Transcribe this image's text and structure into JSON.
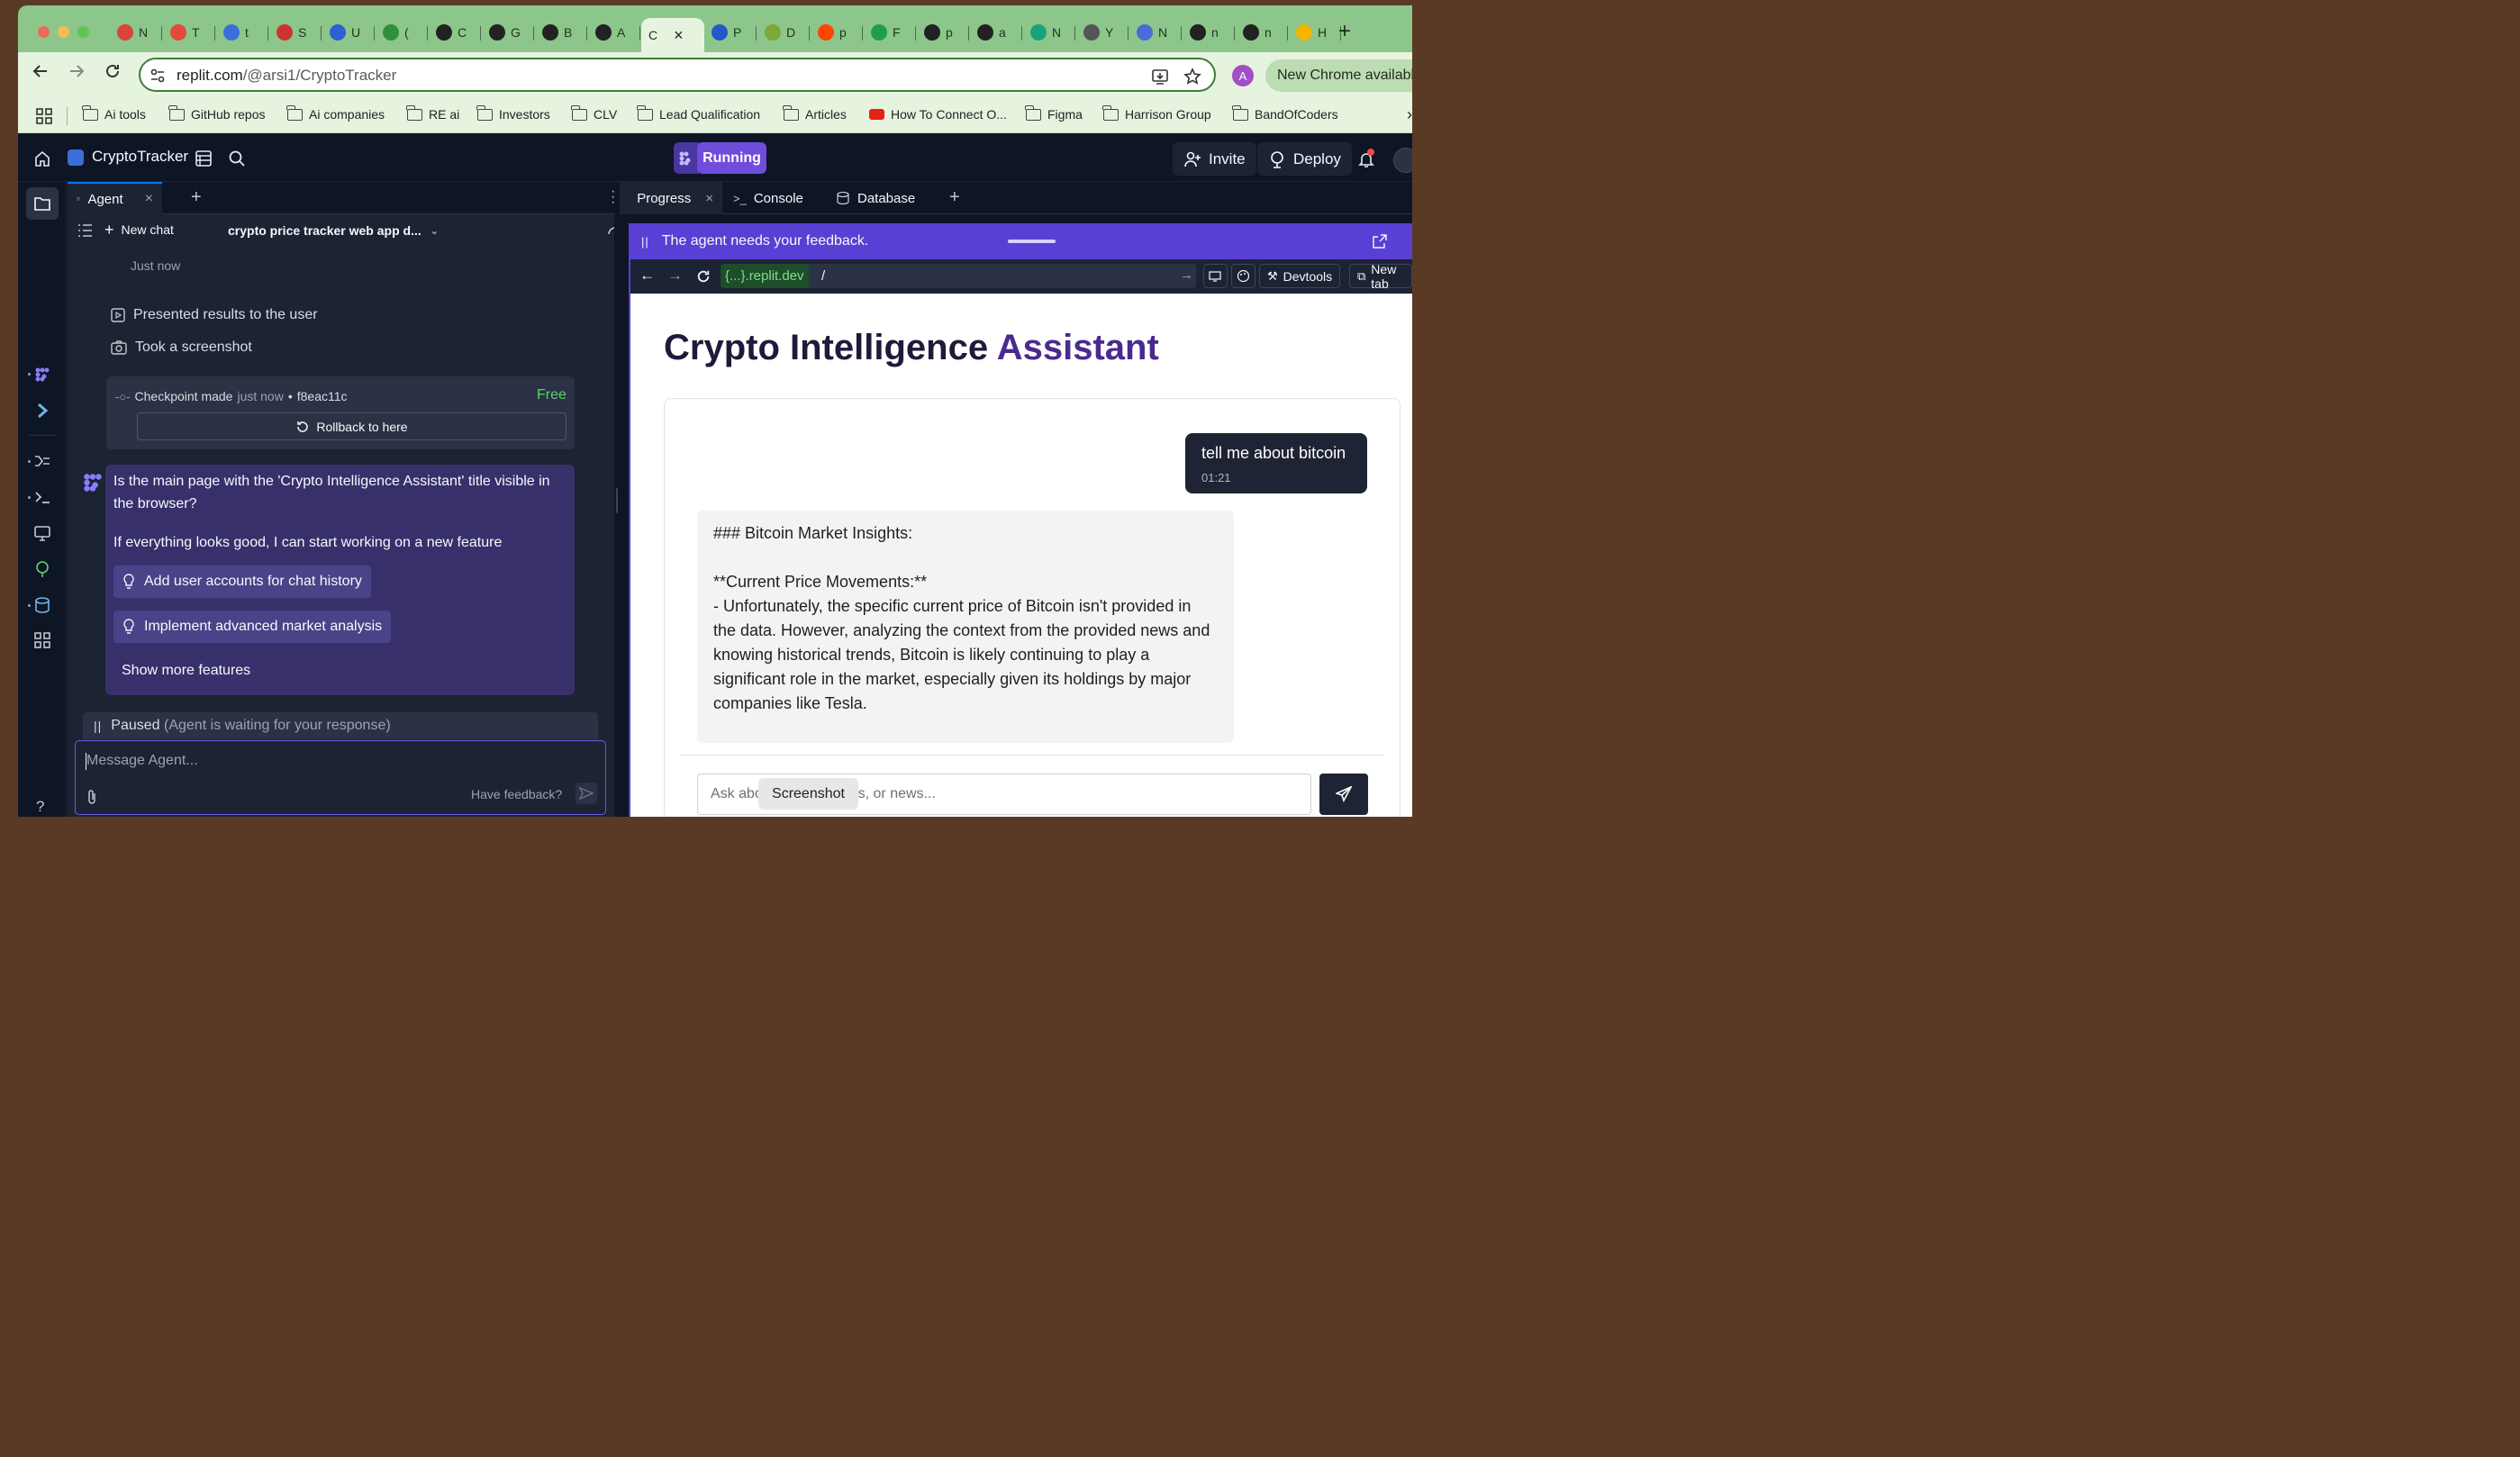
{
  "browser": {
    "tabs": [
      {
        "letter": "N",
        "color": "#d9453a"
      },
      {
        "letter": "T",
        "color": "#e24a3b"
      },
      {
        "letter": "t",
        "color": "#3a6fd8"
      },
      {
        "letter": "S",
        "color": "#c33"
      },
      {
        "letter": "U",
        "color": "#2f5fd0"
      },
      {
        "letter": "(",
        "color": "#2f8f3f"
      },
      {
        "letter": "C",
        "color": "#222"
      },
      {
        "letter": "G",
        "color": "#222"
      },
      {
        "letter": "B",
        "color": "#222"
      },
      {
        "letter": "A",
        "color": "#222"
      },
      {
        "letter": "C",
        "color": "#e6f3df",
        "active": true
      },
      {
        "letter": "P",
        "color": "#2458c8"
      },
      {
        "letter": "D",
        "color": "#7da83a"
      },
      {
        "letter": "p",
        "color": "#ff4500"
      },
      {
        "letter": "F",
        "color": "#1e9e4a"
      },
      {
        "letter": "p",
        "color": "#222"
      },
      {
        "letter": "a",
        "color": "#222"
      },
      {
        "letter": "N",
        "color": "#1aa37a"
      },
      {
        "letter": "Y",
        "color": "#555"
      },
      {
        "letter": "N",
        "color": "#4a6bd8"
      },
      {
        "letter": "n",
        "color": "#222"
      },
      {
        "letter": "n",
        "color": "#222"
      },
      {
        "letter": "H",
        "color": "#f4b400"
      }
    ],
    "url_host": "replit.com",
    "url_path": "/@arsi1/CryptoTracker",
    "profile_initial": "A",
    "update_label": "New Chrome available",
    "bookmarks": [
      "Ai tools",
      "GitHub repos",
      "Ai companies",
      "RE ai",
      "Investors",
      "CLV",
      "Lead Qualification",
      "Articles",
      "How To Connect O...",
      "Figma",
      "Harrison Group",
      "BandOfCoders"
    ]
  },
  "header": {
    "project_name": "CryptoTracker",
    "run_status": "Running",
    "invite_label": "Invite",
    "deploy_label": "Deploy"
  },
  "agent_panel": {
    "tab_label": "Agent",
    "new_chat_label": "New chat",
    "chat_title": "crypto price tracker web app d...",
    "timestamp": "Just now",
    "events": [
      "Presented results to the user",
      "Took a screenshot"
    ],
    "checkpoint": {
      "label": "Checkpoint made",
      "when": "just now",
      "sep": "•",
      "hash": "f8eac11c",
      "cost": "Free",
      "rollback_label": "Rollback to here"
    },
    "message": {
      "question": "Is the main page with the 'Crypto Intelligence Assistant' title visible in the browser?",
      "followup": "If everything looks good, I can start working on a new feature",
      "suggestions": [
        "Add user accounts for chat history",
        "Implement advanced market analysis"
      ],
      "more_label": "Show more features"
    },
    "paused_label": "Paused",
    "paused_detail": "(Agent is waiting for your response)",
    "input_placeholder": "Message Agent...",
    "feedback_label": "Have feedback?"
  },
  "right_panel": {
    "tabs": [
      "Progress",
      "Console",
      "Database"
    ],
    "feedback_banner": "The agent needs your feedback.",
    "address_host": "{...}.replit.dev",
    "address_path": "/",
    "devtools_label": "Devtools",
    "newtab_label": "New tab"
  },
  "app_page": {
    "title_part1": "Crypto Intelligence",
    "title_part2": "Assistant",
    "user_message": "tell me about bitcoin",
    "user_time": "01:21",
    "assistant_heading": "### Bitcoin Market Insights:",
    "assistant_sub": "**Current Price Movements:**",
    "assistant_body": "- Unfortunately, the specific current price of Bitcoin isn't provided in the data. However, analyzing the context from the provided news and knowing historical trends, Bitcoin is likely continuing to play a significant role in the market, especially given its holdings by major companies like Tesla.",
    "ask_placeholder": "Ask about prices, trends, or news...",
    "tooltip": "Screenshot"
  },
  "colors": {
    "accent": "#5a3fd4",
    "running": "#6e4ddb",
    "free": "#5bd46a",
    "chrome": "#8cc68a"
  }
}
